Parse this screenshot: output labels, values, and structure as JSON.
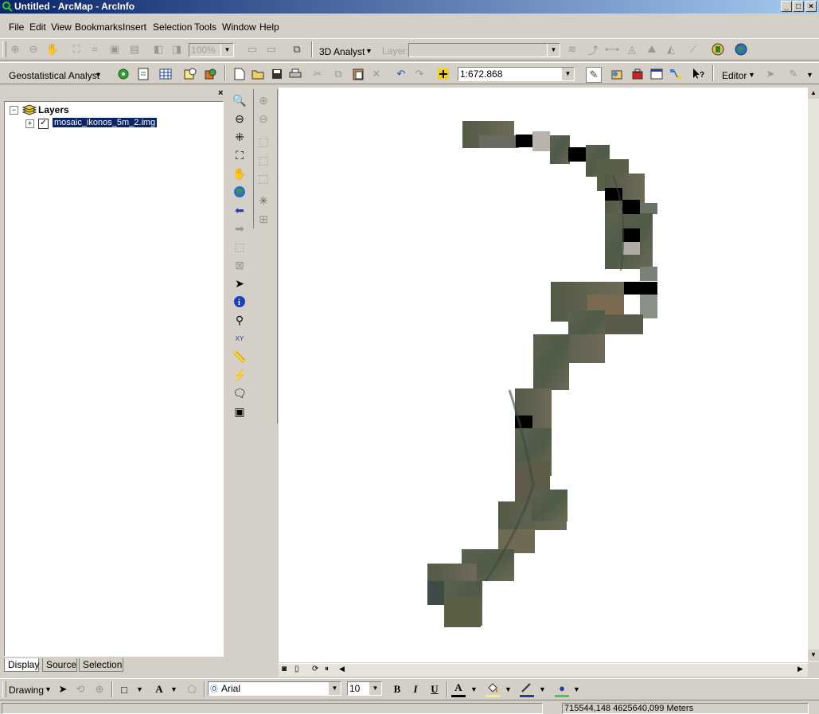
{
  "window": {
    "title": "Untitled - ArcMap - ArcInfo"
  },
  "menu": [
    "File",
    "Edit",
    "View",
    "Bookmarks",
    "Insert",
    "Selection",
    "Tools",
    "Window",
    "Help"
  ],
  "toolbar1": {
    "zoom_value": "100%",
    "analyst3d_label": "3D Analyst",
    "layer_label": "Layer:",
    "layer_value": ""
  },
  "toolbar2": {
    "geostat_label": "Geostatistical Analyst",
    "scale_value": "1:672.868",
    "editor_label": "Editor"
  },
  "toc": {
    "root_label": "Layers",
    "layers": [
      {
        "name": "mosaic_ikonos_5m_2.img",
        "checked": true
      }
    ],
    "tabs": [
      "Display",
      "Source",
      "Selection"
    ],
    "active_tab": "Display"
  },
  "drawing": {
    "label": "Drawing",
    "font_name": "Arial",
    "font_size": "10",
    "bold": "B",
    "italic": "I",
    "underline": "U",
    "text_color_glyph": "A"
  },
  "status": {
    "coords": "715544,148  4625640,099 Meters"
  },
  "colors": {
    "title_start": "#0a246a",
    "title_end": "#a6caf0",
    "chrome": "#d4d0c8",
    "selection": "#0a246a"
  }
}
